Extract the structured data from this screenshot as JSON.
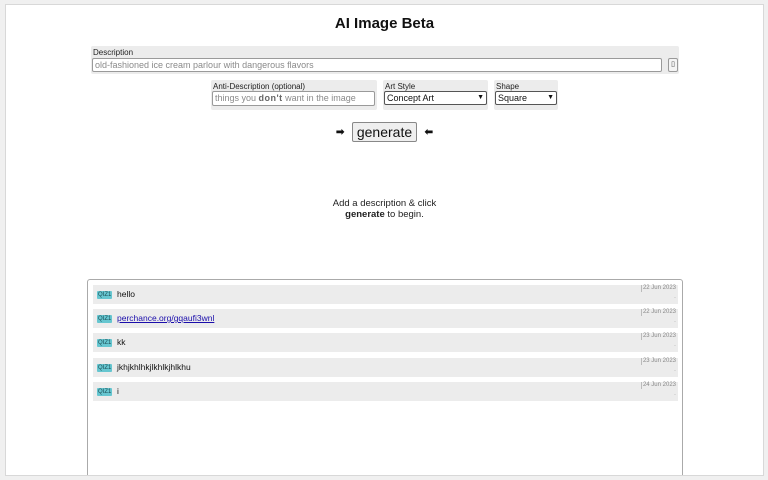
{
  "app": {
    "title": "AI Image Beta"
  },
  "description": {
    "label": "Description",
    "placeholder": "old-fashioned ice cream parlour with dangerous flavors",
    "button_icon": "options-icon"
  },
  "anti_description": {
    "label": "Anti-Description (optional)",
    "placeholder_pre": "things you ",
    "placeholder_bold": "don't",
    "placeholder_post": " want in the image"
  },
  "art_style": {
    "label": "Art Style",
    "selected": "Concept Art"
  },
  "shape": {
    "label": "Shape",
    "selected": "Square"
  },
  "generate": {
    "label": "generate",
    "left_arrow": "➡",
    "right_arrow": "⬅"
  },
  "hint": {
    "line1": "Add a description & click",
    "bold": "generate",
    "line2_rest": " to begin."
  },
  "feed": {
    "messages": [
      {
        "badge": "QIZ1",
        "text": "hello",
        "date": "22 Jun 2023",
        "dot": "·"
      },
      {
        "badge": "QIZ1",
        "text": "perchance.org/gqaufi3wnl",
        "date": "22 Jun 2023",
        "dot": "·",
        "link": true
      },
      {
        "badge": "QIZ1",
        "text": "kk",
        "date": "23 Jun 2023",
        "dot": "·"
      },
      {
        "badge": "QIZ1",
        "text": "jkhjkhlhkjlkhlkjhlkhu",
        "date": "23 Jun 2023",
        "dot": "·"
      },
      {
        "badge": "QIZ1",
        "text": "i",
        "date": "24 Jun 2023",
        "dot": "·"
      }
    ]
  }
}
